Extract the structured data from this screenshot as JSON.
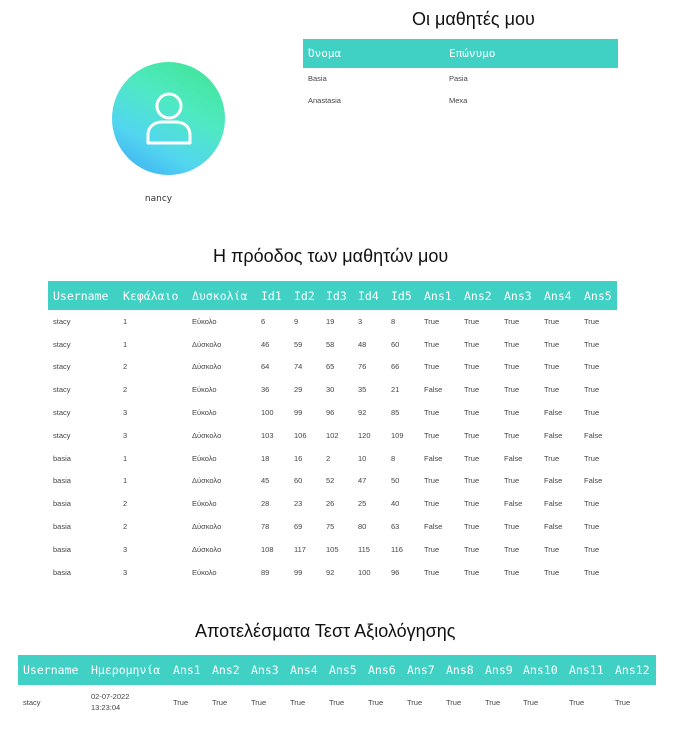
{
  "profile": {
    "username": "nancy",
    "avatar_icon": "user-icon",
    "avatar_gradient": [
      "#3ee48f",
      "#52d6f0",
      "#3aa7f2"
    ]
  },
  "students_section": {
    "title": "Οι μαθητές μου",
    "columns": [
      "Όνομα",
      "Επώνυμο"
    ],
    "rows": [
      [
        "Basia",
        "Pasia"
      ],
      [
        "Anastasia",
        "Mexa"
      ]
    ]
  },
  "progress_section": {
    "title": "Η πρόοδος των μαθητών μου",
    "columns": [
      "Username",
      "Κεφάλαιο",
      "Δυσκολία",
      "Id1",
      "Id2",
      "Id3",
      "Id4",
      "Id5",
      "Ans1",
      "Ans2",
      "Ans3",
      "Ans4",
      "Ans5"
    ],
    "rows": [
      [
        "stacy",
        "1",
        "Εύκολο",
        "6",
        "9",
        "19",
        "3",
        "8",
        "True",
        "True",
        "True",
        "True",
        "True"
      ],
      [
        "stacy",
        "1",
        "Δύσκολο",
        "46",
        "59",
        "58",
        "48",
        "60",
        "True",
        "True",
        "True",
        "True",
        "True"
      ],
      [
        "stacy",
        "2",
        "Δύσκολο",
        "64",
        "74",
        "65",
        "76",
        "66",
        "True",
        "True",
        "True",
        "True",
        "True"
      ],
      [
        "stacy",
        "2",
        "Εύκολο",
        "36",
        "29",
        "30",
        "35",
        "21",
        "False",
        "True",
        "True",
        "True",
        "True"
      ],
      [
        "stacy",
        "3",
        "Εύκολο",
        "100",
        "99",
        "96",
        "92",
        "85",
        "True",
        "True",
        "True",
        "False",
        "True"
      ],
      [
        "stacy",
        "3",
        "Δύσκολο",
        "103",
        "106",
        "102",
        "120",
        "109",
        "True",
        "True",
        "True",
        "False",
        "False"
      ],
      [
        "basia",
        "1",
        "Εύκολο",
        "18",
        "16",
        "2",
        "10",
        "8",
        "False",
        "True",
        "False",
        "True",
        "True"
      ],
      [
        "basia",
        "1",
        "Δύσκολο",
        "45",
        "60",
        "52",
        "47",
        "50",
        "True",
        "True",
        "True",
        "False",
        "False"
      ],
      [
        "basia",
        "2",
        "Εύκολο",
        "28",
        "23",
        "26",
        "25",
        "40",
        "True",
        "True",
        "False",
        "False",
        "True"
      ],
      [
        "basia",
        "2",
        "Δύσκολο",
        "78",
        "69",
        "75",
        "80",
        "63",
        "False",
        "True",
        "True",
        "False",
        "True"
      ],
      [
        "basia",
        "3",
        "Δύσκολο",
        "108",
        "117",
        "105",
        "115",
        "116",
        "True",
        "True",
        "True",
        "True",
        "True"
      ],
      [
        "basia",
        "3",
        "Εύκολο",
        "89",
        "99",
        "92",
        "100",
        "96",
        "True",
        "True",
        "True",
        "True",
        "True"
      ]
    ]
  },
  "tests_section": {
    "title": "Αποτελέσματα Τεστ Αξιολόγησης",
    "columns": [
      "Username",
      "Ημερομηνία",
      "Ans1",
      "Ans2",
      "Ans3",
      "Ans4",
      "Ans5",
      "Ans6",
      "Ans7",
      "Ans8",
      "Ans9",
      "Ans10",
      "Ans11",
      "Ans12"
    ],
    "rows": [
      {
        "username": "stacy",
        "date": "02-07-2022",
        "time": "13:23:04",
        "answers": [
          "True",
          "True",
          "True",
          "True",
          "True",
          "True",
          "True",
          "True",
          "True",
          "True",
          "True",
          "True"
        ]
      }
    ]
  },
  "colors": {
    "header_bg": "#40d0c4",
    "header_text": "#ffffff"
  }
}
